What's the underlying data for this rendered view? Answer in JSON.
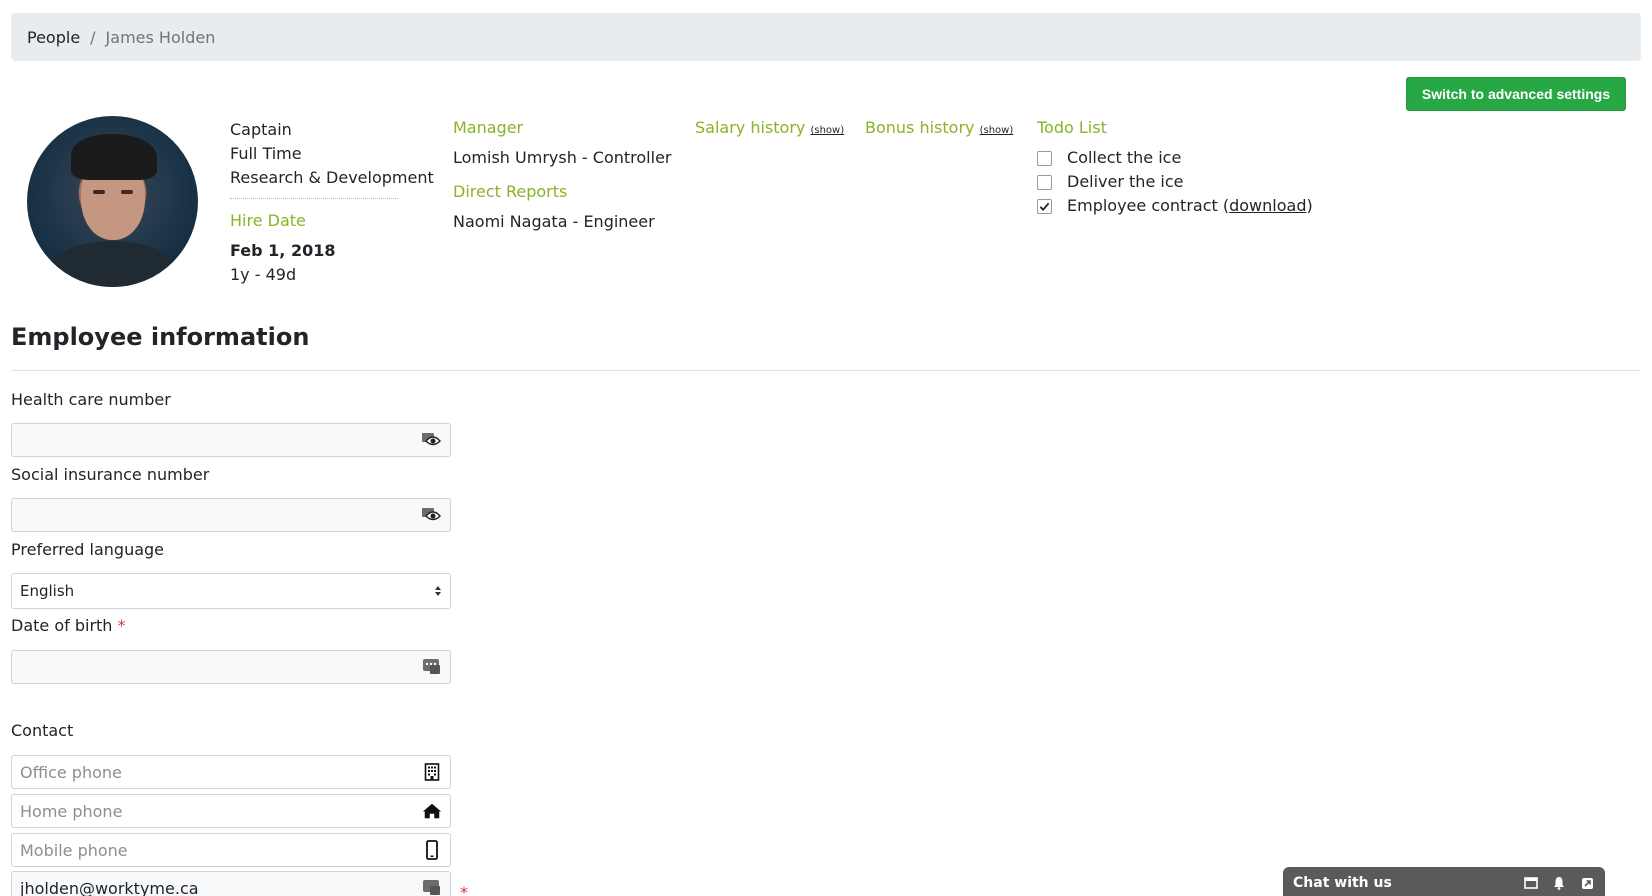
{
  "breadcrumb": {
    "root": "People",
    "separator": "/",
    "current": "James Holden"
  },
  "header": {
    "advanced_button": "Switch to advanced settings"
  },
  "profile": {
    "title": "Captain",
    "employment": "Full Time",
    "department": "Research & Development",
    "hire_label": "Hire Date",
    "hire_date": "Feb 1, 2018",
    "tenure": "1y - 49d"
  },
  "manager": {
    "label": "Manager",
    "value": "Lomish Umrysh - Controller"
  },
  "direct_reports": {
    "label": "Direct Reports",
    "value": "Naomi Nagata - Engineer"
  },
  "salary_history": {
    "label": "Salary history",
    "link": "(show)"
  },
  "bonus_history": {
    "label": "Bonus history",
    "link": "(show)"
  },
  "todo": {
    "label": "Todo List",
    "items": [
      {
        "text": "Collect the ice",
        "checked": false
      },
      {
        "text": "Deliver the ice",
        "checked": false
      },
      {
        "text": "Employee contract (",
        "link": "download",
        "suffix": ")",
        "checked": true
      }
    ]
  },
  "employee_info": {
    "title": "Employee information",
    "health_label": "Health care number",
    "sin_label": "Social insurance number",
    "language_label": "Preferred language",
    "language_value": "English",
    "dob_label": "Date of birth",
    "required_mark": "*"
  },
  "contact": {
    "label": "Contact",
    "office_placeholder": "Office phone",
    "home_placeholder": "Home phone",
    "mobile_placeholder": "Mobile phone",
    "email_value": "jholden@worktyme.ca"
  },
  "chat": {
    "label": "Chat with us"
  },
  "colors": {
    "accent_green": "#8ab327",
    "button_green": "#28a745",
    "required_red": "#dc3545"
  }
}
